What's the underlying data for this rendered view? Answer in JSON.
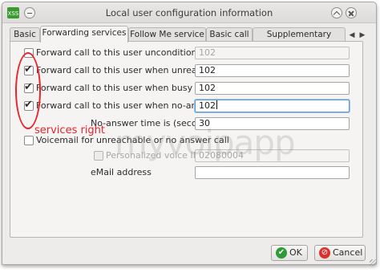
{
  "window": {
    "title": "Local user configuration information"
  },
  "tabs": [
    {
      "label": "Basic"
    },
    {
      "label": "Forwarding services",
      "active": true
    },
    {
      "label": "Follow Me service"
    },
    {
      "label": "Basic call"
    },
    {
      "label": "Supplementary services"
    }
  ],
  "form": {
    "rows": [
      {
        "label": "Forward call to this user unconditionally",
        "checked": false,
        "value": "102",
        "enabled": false
      },
      {
        "label": "Forward call to this user when unreachable",
        "checked": true,
        "value": "102",
        "enabled": true
      },
      {
        "label": "Forward call to this user when busy",
        "checked": true,
        "value": "102",
        "enabled": true
      },
      {
        "label": "Forward call to this user when no-answer",
        "checked": true,
        "value": "102",
        "enabled": true,
        "focused": true
      }
    ],
    "no_answer": {
      "label": "No-answer time is (seconds)",
      "value": "30"
    },
    "voicemail": {
      "label": "Voicemail for unreachable or no answer call",
      "checked": false
    },
    "voice_id": {
      "label": "Personalized voice ID",
      "value": "02080004",
      "enabled": false
    },
    "email": {
      "label": "eMail address",
      "value": ""
    }
  },
  "annotation": {
    "text": "services right",
    "color": "#e8242c"
  },
  "watermark": {
    "text": "myvoipapp"
  },
  "buttons": {
    "ok": "OK",
    "cancel": "Cancel"
  },
  "colors": {
    "accent_focus": "#5a9ad8",
    "ok_green": "#2e9b38",
    "cancel_red": "#d9312b"
  }
}
